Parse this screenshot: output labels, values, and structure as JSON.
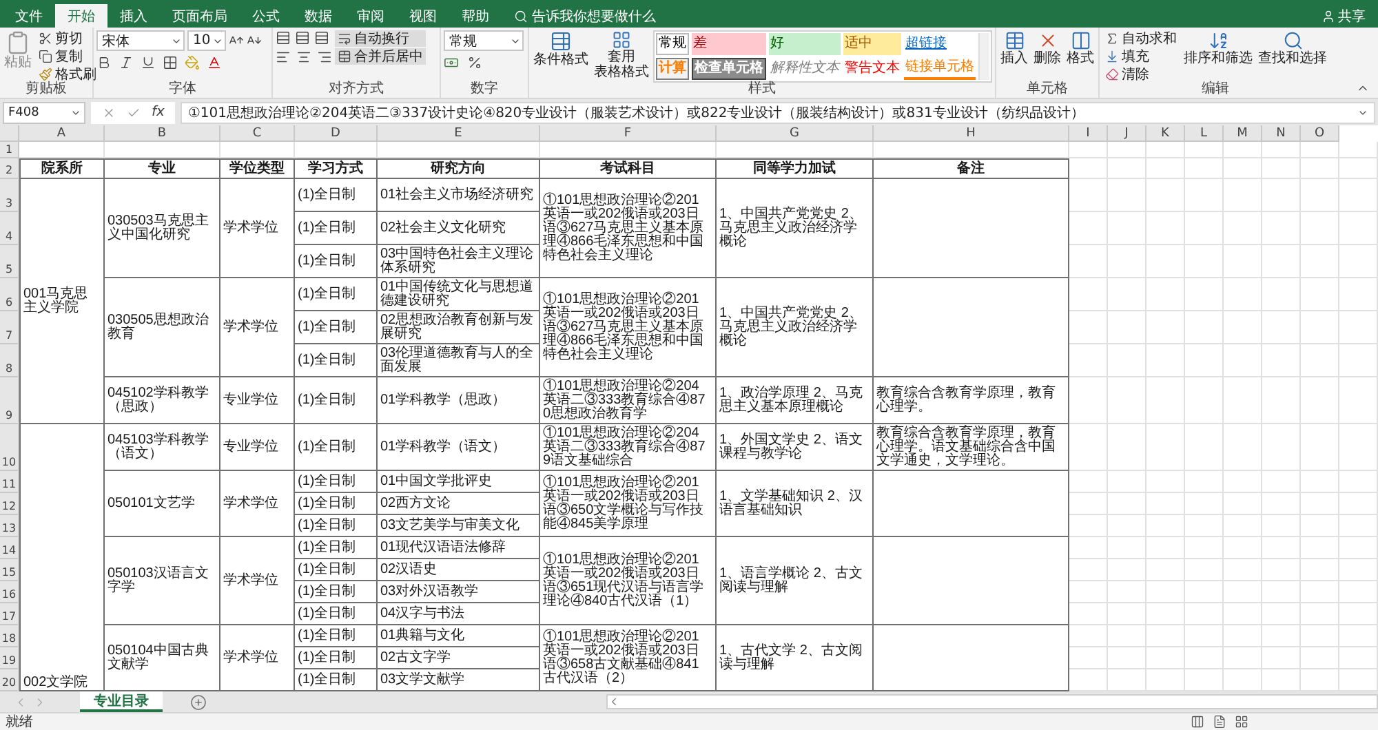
{
  "ribbon_tabs": [
    {
      "label": "文件",
      "selected": false
    },
    {
      "label": "开始",
      "selected": true
    },
    {
      "label": "插入",
      "selected": false
    },
    {
      "label": "页面布局",
      "selected": false
    },
    {
      "label": "公式",
      "selected": false
    },
    {
      "label": "数据",
      "selected": false
    },
    {
      "label": "审阅",
      "selected": false
    },
    {
      "label": "视图",
      "selected": false
    },
    {
      "label": "帮助",
      "selected": false
    }
  ],
  "tell_me": "告诉我你想要做什么",
  "share": "共享",
  "clipboard": {
    "paste": "粘贴",
    "cut": "剪切",
    "copy": "复制",
    "format_painter": "格式刷",
    "group": "剪贴板"
  },
  "font": {
    "name": "宋体",
    "size": "10",
    "group": "字体"
  },
  "alignment": {
    "wrap": "自动换行",
    "merge": "合并后居中",
    "group": "对齐方式"
  },
  "number": {
    "format": "常规",
    "group": "数字"
  },
  "styles": {
    "conditional": "条件格式",
    "table_1": "套用",
    "table_2": "表格格式",
    "group": "样式",
    "gallery": [
      {
        "label": "常规",
        "kind": "normal"
      },
      {
        "label": "差",
        "kind": "bad"
      },
      {
        "label": "好",
        "kind": "good"
      },
      {
        "label": "适中",
        "kind": "neutral"
      },
      {
        "label": "超链接",
        "kind": "hyperlink"
      },
      {
        "label": "计算",
        "kind": "calculation"
      },
      {
        "label": "检查单元格",
        "kind": "check"
      },
      {
        "label": "解释性文本",
        "kind": "explanatory"
      },
      {
        "label": "警告文本",
        "kind": "warning"
      },
      {
        "label": "链接单元格",
        "kind": "linked"
      }
    ]
  },
  "cells": {
    "insert": "插入",
    "delete": "删除",
    "format": "格式",
    "group": "单元格"
  },
  "editing": {
    "autosum": "自动求和",
    "fill": "填充",
    "clear": "清除",
    "sort": "排序和筛选",
    "find": "查找和选择",
    "group": "编辑"
  },
  "formula_bar": {
    "name_box": "F408",
    "fx": "fx",
    "content": "①101思想政治理论②204英语二③337设计史论④820专业设计（服装艺术设计）或822专业设计（服装结构设计）或831专业设计（纺织品设计）"
  },
  "column_letters": [
    "A",
    "B",
    "C",
    "D",
    "E",
    "F",
    "G",
    "H",
    "I",
    "J",
    "K",
    "L",
    "M",
    "N",
    "O"
  ],
  "row_numbers": [
    "1",
    "2",
    "3",
    "4",
    "5",
    "6",
    "7",
    "8",
    "9",
    "10",
    "11",
    "12",
    "13",
    "14",
    "15",
    "16",
    "17",
    "18",
    "19",
    "20"
  ],
  "table": {
    "columns": [
      "院系所",
      "专业",
      "学位类型",
      "学习方式",
      "研究方向",
      "考试科目",
      "同等学力加试",
      "备注"
    ],
    "departments": [
      {
        "name": "001马克思主义学院",
        "programs": [
          {
            "major": "030503马克思主义中国化研究",
            "degree": "学术学位",
            "exam": "①101思想政治理论②201英语一或202俄语或203日语③627马克思主义基本原理④866毛泽东思想和中国特色社会主义理论",
            "extra": "1、中国共产党党史  2、马克思主义政治经济学概论",
            "directions": [
              {
                "mode": "(1)全日制",
                "name": "01社会主义市场经济研究"
              },
              {
                "mode": "(1)全日制",
                "name": "02社会主义文化研究"
              },
              {
                "mode": "(1)全日制",
                "name": "03中国特色社会主义理论体系研究"
              }
            ]
          },
          {
            "major": "030505思想政治教育",
            "degree": "学术学位",
            "exam": "①101思想政治理论②201英语一或202俄语或203日语③627马克思主义基本原理④866毛泽东思想和中国特色社会主义理论",
            "extra": "1、中国共产党党史  2、马克思主义政治经济学概论",
            "directions": [
              {
                "mode": "(1)全日制",
                "name": "01中国传统文化与思想道德建设研究"
              },
              {
                "mode": "(1)全日制",
                "name": "02思想政治教育创新与发展研究"
              },
              {
                "mode": "(1)全日制",
                "name": "03伦理道德教育与人的全面发展"
              }
            ]
          },
          {
            "major": "045102学科教学（思政）",
            "degree": "专业学位",
            "exam": "①101思想政治理论②204英语二③333教育综合④870思想政治教育学",
            "extra": "1、政治学原理  2、马克思主义基本原理概论",
            "note": "教育综合含教育学原理，教育心理学。",
            "directions": [
              {
                "mode": "(1)全日制",
                "name": "01学科教学（思政）"
              }
            ]
          }
        ]
      },
      {
        "name": "002文学院",
        "programs": [
          {
            "major": "045103学科教学（语文）",
            "degree": "专业学位",
            "exam": "①101思想政治理论②204英语二③333教育综合④879语文基础综合",
            "extra": "1、外国文学史  2、语文课程与教学论",
            "note": "教育综合含教育学原理，教育心理学。语文基础综合含中国文学通史，文学理论。",
            "directions": [
              {
                "mode": "(1)全日制",
                "name": "01学科教学（语文）"
              }
            ]
          },
          {
            "major": "050101文艺学",
            "degree": "学术学位",
            "exam": "①101思想政治理论②201英语一或202俄语或203日语③650文学概论与写作技能④845美学原理",
            "extra": "1、文学基础知识  2、汉语言基础知识",
            "directions": [
              {
                "mode": "(1)全日制",
                "name": "01中国文学批评史"
              },
              {
                "mode": "(1)全日制",
                "name": "02西方文论"
              },
              {
                "mode": "(1)全日制",
                "name": "03文艺美学与审美文化"
              }
            ]
          },
          {
            "major": "050103汉语言文字学",
            "degree": "学术学位",
            "exam": "①101思想政治理论②201英语一或202俄语或203日语③651现代汉语与语言学理论④840古代汉语（1）",
            "extra": "1、语言学概论 2、古文阅读与理解",
            "directions": [
              {
                "mode": "(1)全日制",
                "name": "01现代汉语语法修辞"
              },
              {
                "mode": "(1)全日制",
                "name": "02汉语史"
              },
              {
                "mode": "(1)全日制",
                "name": "03对外汉语教学"
              },
              {
                "mode": "(1)全日制",
                "name": "04汉字与书法"
              }
            ]
          },
          {
            "major": "050104中国古典文献学",
            "degree": "学术学位",
            "exam": "①101思想政治理论②201英语一或202俄语或203日语③658古文献基础④841古代汉语（2）",
            "extra": "1、古代文学  2、古文阅读与理解",
            "directions": [
              {
                "mode": "(1)全日制",
                "name": "01典籍与文化"
              },
              {
                "mode": "(1)全日制",
                "name": "02古文字学"
              },
              {
                "mode": "(1)全日制",
                "name": "03文学文献学"
              }
            ]
          }
        ]
      }
    ]
  },
  "sheet_tabs": [
    {
      "label": "专业目录",
      "selected": true
    }
  ],
  "status": "就绪"
}
